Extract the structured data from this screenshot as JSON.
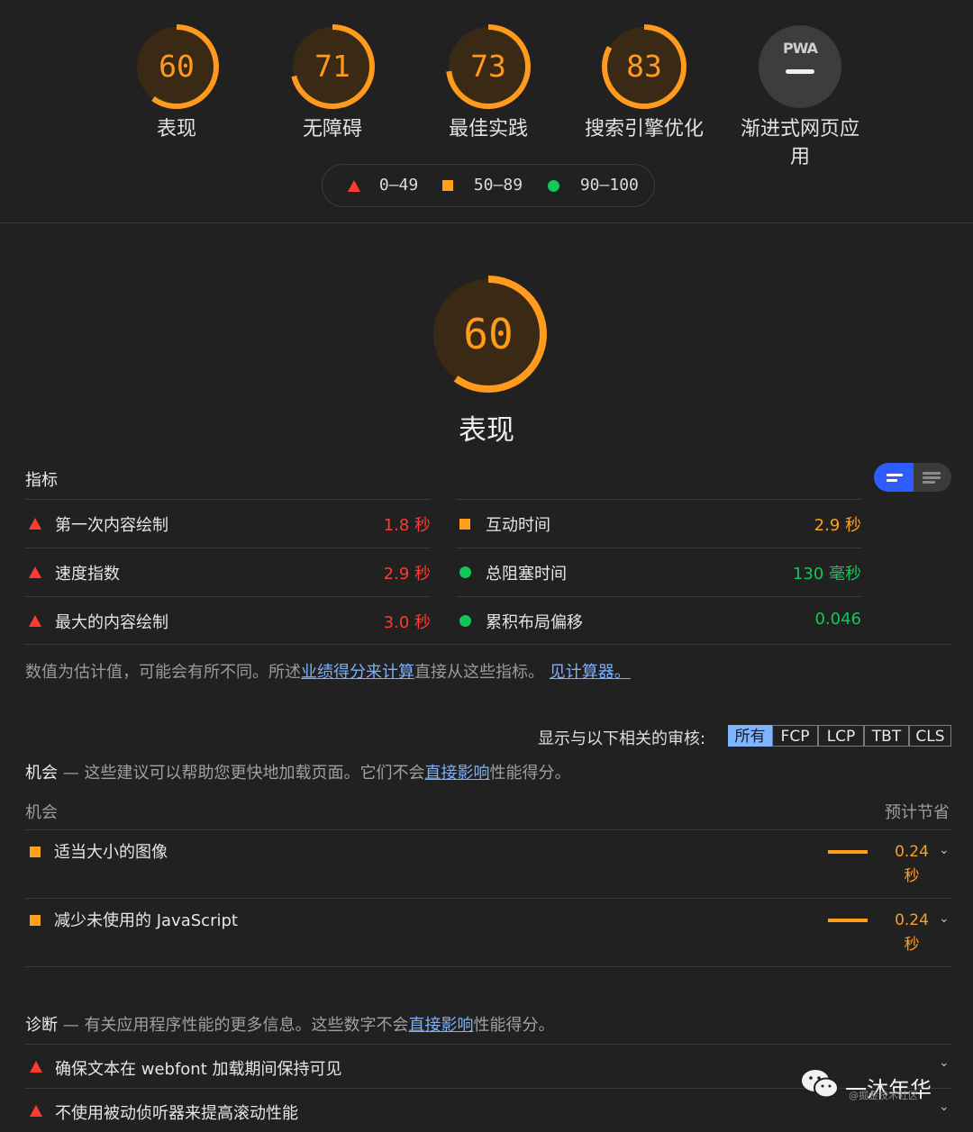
{
  "gauges": [
    {
      "score": "60",
      "label": "表现",
      "fraction": 0.6
    },
    {
      "score": "71",
      "label": "无障碍",
      "fraction": 0.71
    },
    {
      "score": "73",
      "label": "最佳实践",
      "fraction": 0.73
    },
    {
      "score": "83",
      "label": "搜索引擎优化",
      "fraction": 0.83
    }
  ],
  "pwa": {
    "badge": "PWA",
    "label_line1": "渐进式网页应",
    "label_line2": "用"
  },
  "legend": {
    "fail": "0–49",
    "average": "50–89",
    "pass": "90–100"
  },
  "colors": {
    "fail": "#ff3a33",
    "average": "#ff9f1a",
    "pass": "#12c75a",
    "link": "#7ab0ff",
    "toggle_active": "#2f5cff"
  },
  "performance": {
    "score": "60",
    "fraction": 0.6,
    "title": "表现"
  },
  "metrics": {
    "title": "指标",
    "left": [
      {
        "name": "第一次内容绘制",
        "value": "1.8 秒",
        "status": "fail"
      },
      {
        "name": "速度指数",
        "value": "2.9 秒",
        "status": "fail"
      },
      {
        "name": "最大的内容绘制",
        "value": "3.0 秒",
        "status": "fail"
      }
    ],
    "right": [
      {
        "name": "互动时间",
        "value": "2.9 秒",
        "status": "average"
      },
      {
        "name": "总阻塞时间",
        "value": "130 毫秒",
        "status": "pass"
      },
      {
        "name": "累积布局偏移",
        "value": "0.046",
        "status": "pass"
      }
    ],
    "note_prefix": "数值为估计值，可能会有所不同。所述",
    "note_link1": "业绩得分来计算",
    "note_middle": "直接从这些指标。",
    "note_link2": "见计算器。"
  },
  "filter": {
    "label": "显示与以下相关的审核:",
    "chips": [
      "所有",
      "FCP",
      "LCP",
      "TBT",
      "CLS"
    ],
    "active": "所有"
  },
  "opportunities": {
    "title": "机会",
    "dash": " — ",
    "desc_prefix": "这些建议可以帮助您更快地加载页面。它们不会",
    "desc_link": "直接影响",
    "desc_suffix": "性能得分。",
    "col_left": "机会",
    "col_right": "预计节省",
    "items": [
      {
        "name": "适当大小的图像",
        "saving_value": "0.24",
        "saving_unit": "秒",
        "icon": "orange-square-icon"
      },
      {
        "name": "减少未使用的 JavaScript",
        "saving_value": "0.24",
        "saving_unit": "秒",
        "icon": "orange-square-icon"
      }
    ]
  },
  "diagnostics": {
    "title": "诊断",
    "dash": " — ",
    "desc_prefix": "有关应用程序性能的更多信息。这些数字不会",
    "desc_link": "直接影响",
    "desc_suffix": "性能得分。",
    "items": [
      {
        "name": "确保文本在 webfont 加载期间保持可见",
        "icon": "red-triangle-icon"
      },
      {
        "name": "不使用被动侦听器来提高滚动性能",
        "icon": "red-triangle-icon"
      }
    ]
  },
  "watermark": {
    "brand": "一沐年华",
    "sub": "@掘金技术社区"
  }
}
